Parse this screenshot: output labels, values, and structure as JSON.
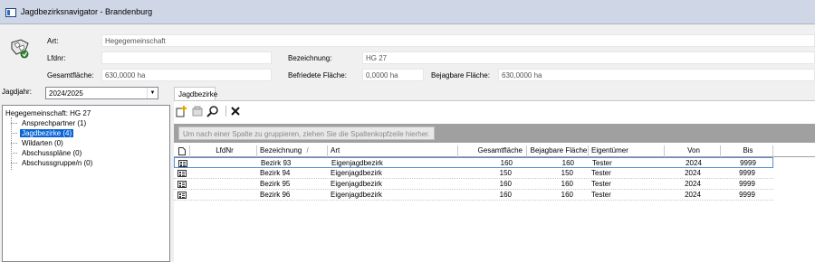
{
  "window": {
    "title": "Jagdbezirksnavigator - Brandenburg"
  },
  "header": {
    "icon": "hunting-district-icon",
    "art_label": "Art:",
    "art_value": "Hegegemeinschaft",
    "lfdnr_label": "Lfdnr:",
    "lfdnr_value": "",
    "bezeichnung_label": "Bezeichnung:",
    "bezeichnung_value": "HG 27",
    "gesamtflaeche_label": "Gesamtfläche:",
    "gesamtflaeche_value": "630,0000 ha",
    "befriedete_label": "Befriedete Fläche:",
    "befriedete_value": "0,0000 ha",
    "bejagbare_label": "Bejagbare Fläche:",
    "bejagbare_value": "630,0000 ha"
  },
  "jagdjahr": {
    "label": "Jagdjahr:",
    "value": "2024/2025"
  },
  "tree": {
    "root": "Hegegemeinschaft: HG 27",
    "items": [
      {
        "label": "Ansprechpartner (1)"
      },
      {
        "label": "Jagdbezirke (4)"
      },
      {
        "label": "Wildarten (0)"
      },
      {
        "label": "Abschusspläne (0)"
      },
      {
        "label": "Abschussgruppe/n (0)"
      }
    ]
  },
  "tabs": [
    {
      "label": "Jagdbezirke"
    }
  ],
  "toolbar": {
    "icons": [
      "new-icon",
      "properties-icon",
      "search-icon",
      "delete-icon"
    ]
  },
  "grid": {
    "group_hint": "Um nach einer Spalte zu gruppieren, ziehen Sie die Spaltenkopfzeile hierher.",
    "columns": [
      "",
      "LfdNr",
      "Bezeichnung",
      "Art",
      "Gesamtfläche",
      "Bejagbare Fläche",
      "Eigentümer",
      "Von",
      "Bis"
    ],
    "sort_indicator": "/",
    "rows": [
      {
        "lfdnr": "",
        "bezeichnung": "Bezirk 93",
        "art": "Eigenjagdbezirk",
        "gesamt": "160",
        "bejagbar": "160",
        "eigentuemer": "Tester",
        "von": "2024",
        "bis": "9999"
      },
      {
        "lfdnr": "",
        "bezeichnung": "Bezirk 94",
        "art": "Eigenjagdbezirk",
        "gesamt": "150",
        "bejagbar": "150",
        "eigentuemer": "Tester",
        "von": "2024",
        "bis": "9999"
      },
      {
        "lfdnr": "",
        "bezeichnung": "Bezirk 95",
        "art": "Eigenjagdbezirk",
        "gesamt": "160",
        "bejagbar": "160",
        "eigentuemer": "Tester",
        "von": "2024",
        "bis": "9999"
      },
      {
        "lfdnr": "",
        "bezeichnung": "Bezirk 96",
        "art": "Eigenjagdbezirk",
        "gesamt": "160",
        "bejagbar": "160",
        "eigentuemer": "Tester",
        "von": "2024",
        "bis": "9999"
      }
    ]
  }
}
